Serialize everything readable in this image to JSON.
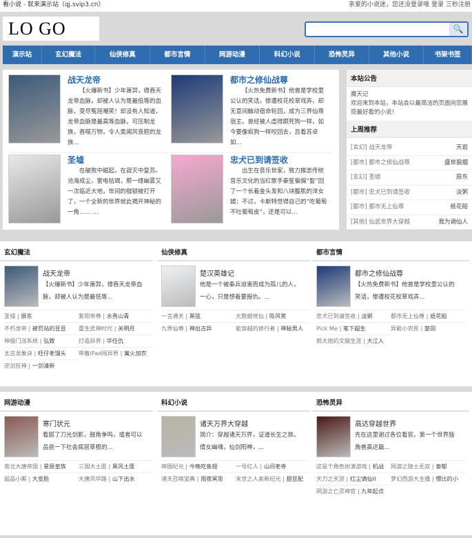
{
  "topbar": {
    "site": "看小说 - 就来演示站（qj.svip3.cn）",
    "greeting": "亲爱的小说迷，您还没登录哦",
    "login": "登录",
    "register": "三秒注册"
  },
  "header": {
    "logo": "LO  GO",
    "search_placeholder": "",
    "search_icon": "🔍"
  },
  "nav": [
    "演示站",
    "玄幻魔法",
    "仙侠修真",
    "都市言情",
    "网游动漫",
    "科幻小说",
    "恐怖灵异",
    "其他小说",
    "书架书签"
  ],
  "featured": [
    {
      "title": "战天龙帝",
      "desc": "【火爆新书】少年萧羿，得吞天龙帝血脉，却被人认为是最低等的血脉，受尽冤屈嘲笑！却没有人知道，龙帝血脉是最高等血脉，可压制龙族，吞噬万物，令人类闻风丧胆的龙族...",
      "color": "#3c5a7a"
    },
    {
      "title": "都市之修仙战尊",
      "desc": "【火热免费新书】他曾是学校里公认的笑话，惨遭校花校草戏弄，却无意间触动宿命轮回，成为三界仙尊宿主。曾经被人虐得跟死狗一样，如今要像疯狗一样咬回去，且看苏卓如...",
      "color": "#1d3a78"
    },
    {
      "title": "圣墟",
      "desc": "在破败中崛起，在寂灭中复苏。沧海成尘，雷电枯竭，那一缕幽雾又一次临近大地，世间的枷锁被打开了，一个全新的世界就此揭开神秘的一角…… ...",
      "color": "#e8e8e8"
    },
    {
      "title": "忠犬已到请签收",
      "desc": "出生在音乐世家，致力推崇传统音乐文化的当红歌手秦笙偏偏“娶”回了一个长着金头发和八块腹肌的洋女婿：不过，卡斯特觉得自己的“吃葡萄不吐葡萄皮”，还是可以...",
      "color": "#f6a9cf"
    }
  ],
  "sidebar": {
    "notice_title": "本站公告",
    "notice_name": "魔天记",
    "notice_text": "欢迎来到本站，本站会以最简洁的页面向您展现最好看的小说！",
    "rec_title": "上周推荐",
    "recs": [
      {
        "cat": "[玄幻]",
        "book": "战天龙帝",
        "author": "天岩"
      },
      {
        "cat": "[都市]",
        "book": "都市之修仙战尊",
        "author": "盛世狼烟"
      },
      {
        "cat": "[玄幻]",
        "book": "圣墟",
        "author": "辰东"
      },
      {
        "cat": "[都市]",
        "book": "忠犬已到请签收",
        "author": "淡粥"
      },
      {
        "cat": "[都市]",
        "book": "都市无上仙尊",
        "author": "纸花船"
      },
      {
        "cat": "[其他]",
        "book": "仙武世界大穿越",
        "author": "我为谪仙人"
      }
    ]
  },
  "sections": [
    {
      "title": "玄幻魔法",
      "book": "战天龙帝",
      "desc": "【火爆新书】少年萧羿，得吞天龙帝血脉，却被人认为是最低等...",
      "color": "#3c5a7a",
      "links": [
        [
          "圣墟",
          "辰东"
        ],
        [
          "紫阳帝尊",
          "水秀山青"
        ],
        [
          "不朽龙帝",
          "被罚站的豆豆"
        ],
        [
          "重生武神时代",
          "关明月"
        ],
        [
          "神级门派系统",
          "弘致"
        ],
        [
          "打造异界",
          "华任仇"
        ],
        [
          "太古龙象诀",
          "旺仔老馒头"
        ],
        [
          "带着iPad闯异界",
          "寓火加农"
        ],
        [
          "逆剑狂神",
          "一剑清新"
        ]
      ]
    },
    {
      "title": "仙侠修真",
      "book": "楚汉英雄记",
      "desc": "他是一个被秦兵迫害而成为孤儿的人，一心，只是想着要报仇。...",
      "color": "#eef1f4",
      "links": [
        [
          "一言通天",
          "黑弦"
        ],
        [
          "大数据修仙",
          "陈风笑"
        ],
        [
          "九界仙尊",
          "神出古异"
        ],
        [
          "能穿越的修行者",
          "神秘男人"
        ]
      ]
    },
    {
      "title": "都市言情",
      "book": "都市之修仙战尊",
      "desc": "【火热免费新书】他曾是学校里公认的笑话，惨遭校花校草戏弄...",
      "color": "#1d3a78",
      "links": [
        [
          "忠犬已到请签收",
          "淡粥"
        ],
        [
          "都市无上仙尊",
          "纸花船"
        ],
        [
          "Pick Me",
          "笔下超生"
        ],
        [
          "异能小农民",
          "楚田"
        ],
        [
          "郭大炮的文娱生涯",
          "大江入"
        ]
      ]
    },
    {
      "title": "网游动漫",
      "book": "寒门状元",
      "desc": "看腻了刀光剑影，鼓角争鸣，或者可以品尝一下社会底层草根的...",
      "color": "#8a5a52",
      "links": [
        [
          "南北大唐帝国",
          "星辰皇族"
        ],
        [
          "三国大土匪",
          "黑风土匪"
        ],
        [
          "超品小厮",
          "大变脸"
        ],
        [
          "大唐风华路",
          "山下出水"
        ]
      ]
    },
    {
      "title": "科幻小说",
      "book": "诸天万界大穿越",
      "desc": "简介：穿越诸天万界，证道长生之旅。倩女幽魂，仙剑阳神，...",
      "color": "#b9b3a5",
      "links": [
        [
          "神国纪元",
          "今晚吃鱼翅"
        ],
        [
          "一号红人",
          "山间老寺"
        ],
        [
          "诸天召唤宝典",
          "雨夜冥思"
        ],
        [
          "末世之人类新纪元",
          "甜豆配"
        ]
      ]
    },
    {
      "title": "恐怖灵异",
      "book": "高达穿越世界",
      "desc": "先在这里谢过各位看官。第一个世界独角兽高达篇...",
      "color": "#4a1a14",
      "links": [
        [
          "这是个角色扮演游戏",
          "机战"
        ],
        [
          "网游之隐士无双",
          "泰郁"
        ],
        [
          "天刀之天涯",
          "红尘谪仙II"
        ],
        [
          "梦幻西游大主播",
          "懵比的小"
        ],
        [
          "网游之亡灵神官",
          "九年起点"
        ]
      ]
    }
  ]
}
